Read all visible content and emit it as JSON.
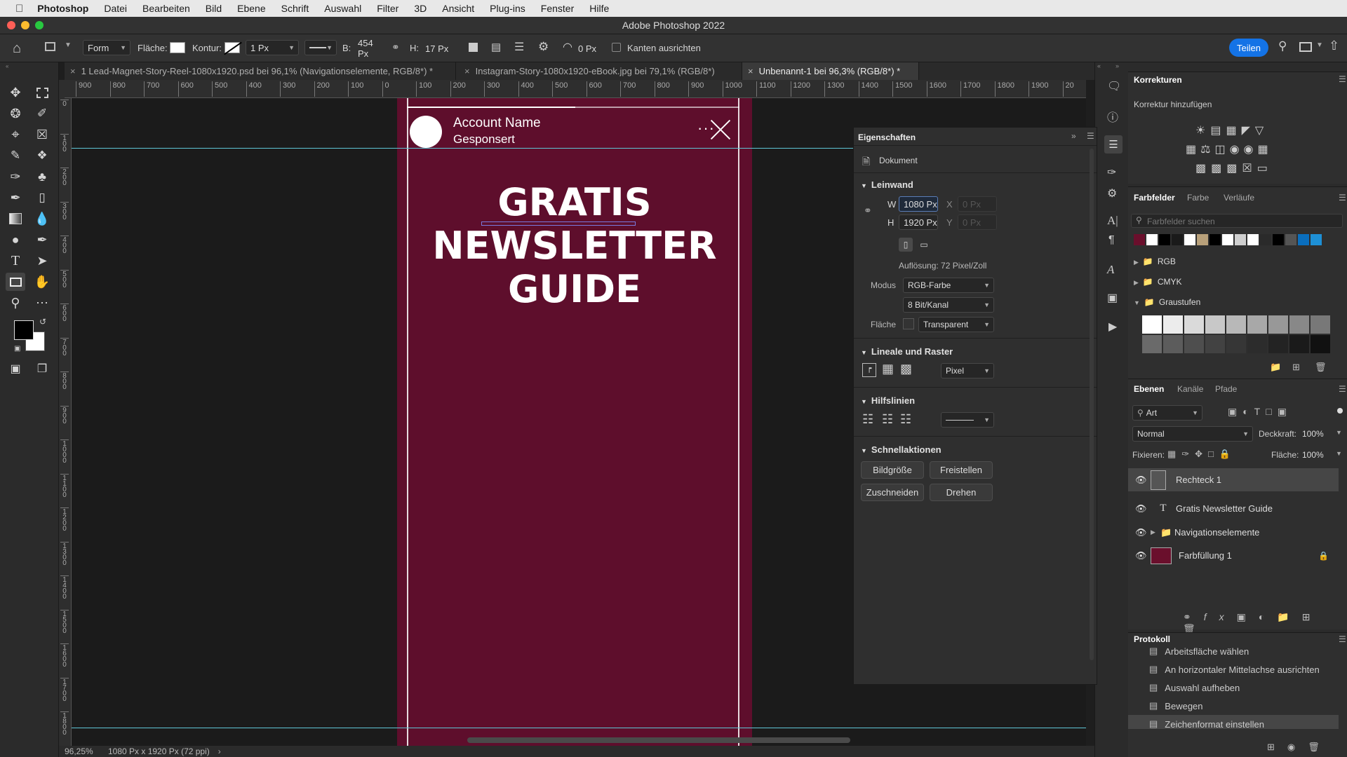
{
  "menubar": {
    "app": "Photoshop",
    "items": [
      "Datei",
      "Bearbeiten",
      "Bild",
      "Ebene",
      "Schrift",
      "Auswahl",
      "Filter",
      "3D",
      "Ansicht",
      "Plug-ins",
      "Fenster",
      "Hilfe"
    ]
  },
  "window": {
    "title": "Adobe Photoshop 2022"
  },
  "options": {
    "tool_mode": "Form",
    "fill_label": "Fläche:",
    "stroke_label": "Kontur:",
    "stroke_width": "1 Px",
    "w_label": "B:",
    "w_value": "454 Px",
    "h_label": "H:",
    "h_value": "17 Px",
    "radius": "0 Px",
    "align_edges": "Kanten ausrichten",
    "share": "Teilen"
  },
  "tabs": [
    {
      "label": "1 Lead-Magnet-Story-Reel-1080x1920.psd bei 96,1% (Navigationselemente, RGB/8*) *",
      "active": false
    },
    {
      "label": "Instagram-Story-1080x1920-eBook.jpg bei 79,1% (RGB/8*)",
      "active": false
    },
    {
      "label": "Unbenannt-1 bei 96,3% (RGB/8*) *",
      "active": true
    }
  ],
  "hruler_ticks": [
    "900",
    "800",
    "700",
    "600",
    "500",
    "400",
    "300",
    "200",
    "100",
    "0",
    "100",
    "200",
    "300",
    "400",
    "500",
    "600",
    "700",
    "800",
    "900",
    "1000",
    "1100",
    "1200",
    "1300",
    "1400",
    "1500",
    "1600",
    "1700",
    "1800",
    "1900",
    "20"
  ],
  "vruler_ticks": [
    "0",
    "1 0 0",
    "2 0 0",
    "3 0 0",
    "4 0 0",
    "5 0 0",
    "6 0 0",
    "7 0 0",
    "8 0 0",
    "9 0 0",
    "1 0 0 0",
    "1 1 0 0",
    "1 2 0 0",
    "1 3 0 0",
    "1 4 0 0",
    "1 5 0 0",
    "1 6 0 0",
    "1 7 0 0",
    "1 8 0 0",
    "1 9 0 0"
  ],
  "artboard": {
    "bg": "#5e0e2c",
    "account_name": "Account Name",
    "sponsored": "Gesponsert",
    "headline_1": "GRATIS",
    "headline_2": "NEWSLETTER",
    "headline_3": "GUIDE"
  },
  "status": {
    "zoom": "96,25%",
    "doc": "1080 Px x 1920 Px (72 ppi)"
  },
  "properties": {
    "title": "Eigenschaften",
    "doc": "Dokument",
    "canvas": "Leinwand",
    "w_label": "W",
    "w": "1080 Px",
    "h_label": "H",
    "h": "1920 Px",
    "x_label": "X",
    "x": "0 Px",
    "y_label": "Y",
    "y": "0 Px",
    "resolution": "Auflösung: 72 Pixel/Zoll",
    "mode_label": "Modus",
    "mode": "RGB-Farbe",
    "depth": "8 Bit/Kanal",
    "fill_label": "Fläche",
    "fill": "Transparent",
    "rulers": "Lineale und Raster",
    "unit": "Pixel",
    "guides": "Hilfslinien",
    "quick": "Schnellaktionen",
    "btn_size": "Bildgröße",
    "btn_cutout": "Freistellen",
    "btn_crop": "Zuschneiden",
    "btn_rotate": "Drehen"
  },
  "adjust": {
    "title": "Korrekturen",
    "add": "Korrektur hinzufügen"
  },
  "swatches": {
    "tabs": [
      "Farbfelder",
      "Farbe",
      "Verläufe"
    ],
    "search": "Farbfelder suchen",
    "colors": [
      "#6a0f2c",
      "#ffffff",
      "#000000",
      "#1a1a1a",
      "#ffffff",
      "#b8a07a",
      "#000000",
      "#ffffff",
      "#cfcfcf",
      "#ffffff",
      "#2a2a2a",
      "#000000",
      "#555555",
      "#0a6ebd",
      "#1e90d6"
    ],
    "groups": [
      "RGB",
      "CMYK",
      "Graustufen"
    ],
    "grays": [
      "#ffffff",
      "#ececec",
      "#dadada",
      "#c8c8c8",
      "#b8b8b8",
      "#a8a8a8",
      "#989898",
      "#888888",
      "#787878",
      "#6a6a6a",
      "#5c5c5c",
      "#4e4e4e",
      "#424242",
      "#363636",
      "#2c2c2c",
      "#232323",
      "#1a1a1a",
      "#111111"
    ]
  },
  "layers": {
    "tabs": [
      "Ebenen",
      "Kanäle",
      "Pfade"
    ],
    "filter": "Art",
    "blend": "Normal",
    "opacity_label": "Deckkraft:",
    "opacity": "100%",
    "lock_label": "Fixieren:",
    "fill_label": "Fläche:",
    "fill": "100%",
    "items": [
      "Rechteck 1",
      "Gratis Newsletter Guide",
      "Navigationselemente",
      "Farbfüllung 1"
    ]
  },
  "history": {
    "title": "Protokoll",
    "items": [
      "Arbeitsfläche wählen",
      "An horizontaler Mittelachse ausrichten",
      "Auswahl aufheben",
      "Bewegen",
      "Zeichenformat einstellen"
    ]
  }
}
